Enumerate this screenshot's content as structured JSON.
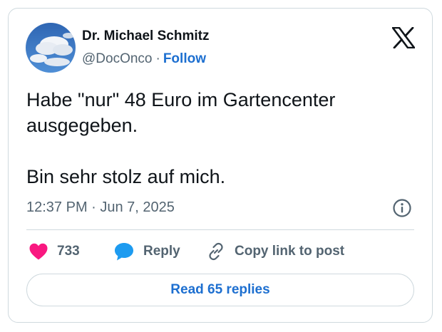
{
  "author": {
    "name": "Dr. Michael Schmitz",
    "handle": "@DocOnco",
    "separator": "·",
    "follow_label": "Follow"
  },
  "tweet": {
    "paragraphs": [
      "Habe \"nur\" 48 Euro im Gartencenter ausgegeben.",
      "Bin sehr stolz auf mich."
    ],
    "timestamp": "12:37 PM · Jun 7, 2025"
  },
  "actions": {
    "like_count": "733",
    "reply_label": "Reply",
    "copy_link_label": "Copy link to post"
  },
  "read_replies_label": "Read 65 replies",
  "icons": {
    "brand": "x-logo-icon",
    "info": "info-icon",
    "like": "heart-icon",
    "reply": "speech-bubble-icon",
    "copy": "link-icon"
  },
  "colors": {
    "accent": "#1d6fd0",
    "secondary_text": "#536471",
    "like": "#f91880",
    "reply": "#1d9bf0",
    "border": "#cfd9de"
  }
}
